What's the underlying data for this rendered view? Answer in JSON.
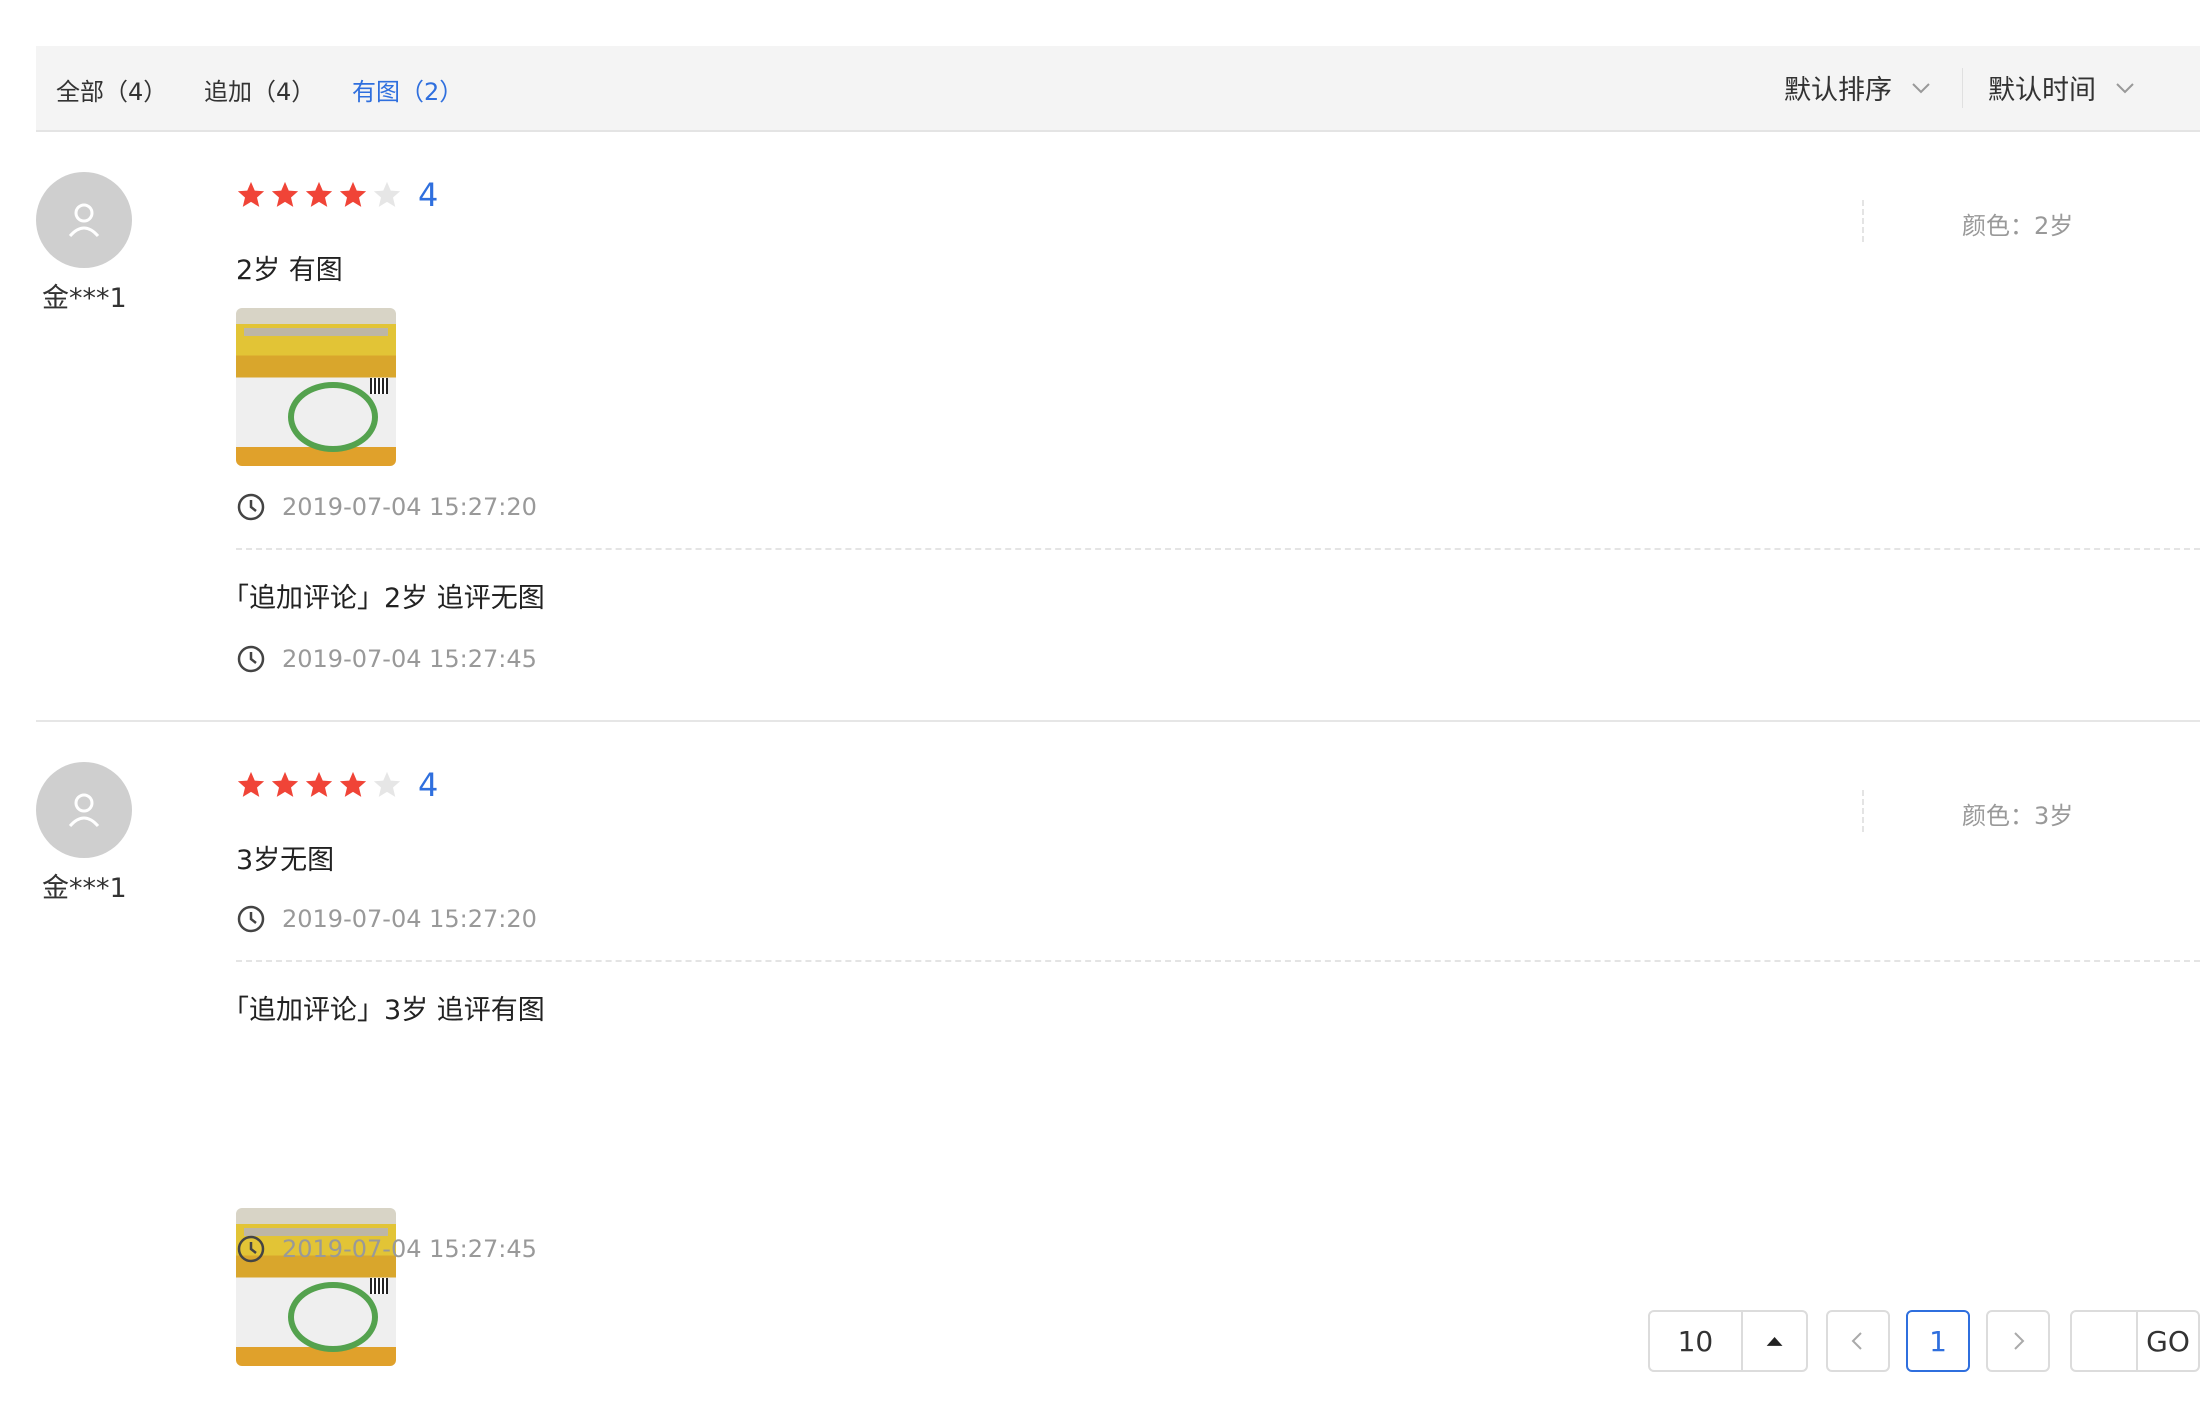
{
  "filters": {
    "tabs": [
      {
        "label": "全部（4）",
        "active": false
      },
      {
        "label": "追加（4）",
        "active": false
      },
      {
        "label": "有图（2）",
        "active": true
      }
    ],
    "sort_label": "默认排序",
    "time_label": "默认时间"
  },
  "reviews": [
    {
      "user": "金***1",
      "rating": 4,
      "rating_max": 5,
      "score_text": "4",
      "text": "2岁 有图",
      "has_image": true,
      "time": "2019-07-04 15:27:20",
      "spec": "颜色：2岁",
      "followup": {
        "text": "「追加评论」2岁 追评无图",
        "has_image": false,
        "time": "2019-07-04 15:27:45"
      }
    },
    {
      "user": "金***1",
      "rating": 4,
      "rating_max": 5,
      "score_text": "4",
      "text": "3岁无图",
      "has_image": false,
      "time": "2019-07-04 15:27:20",
      "spec": "颜色：3岁",
      "followup": {
        "text": "「追加评论」3岁 追评有图",
        "has_image": true,
        "time": "2019-07-04 15:27:45"
      }
    }
  ],
  "pagination": {
    "page_size": "10",
    "current_page": "1",
    "jump_input": "",
    "go_label": "GO"
  },
  "colors": {
    "accent": "#2f6fde",
    "star": "#f04437",
    "star_empty": "#e6e6e6"
  }
}
